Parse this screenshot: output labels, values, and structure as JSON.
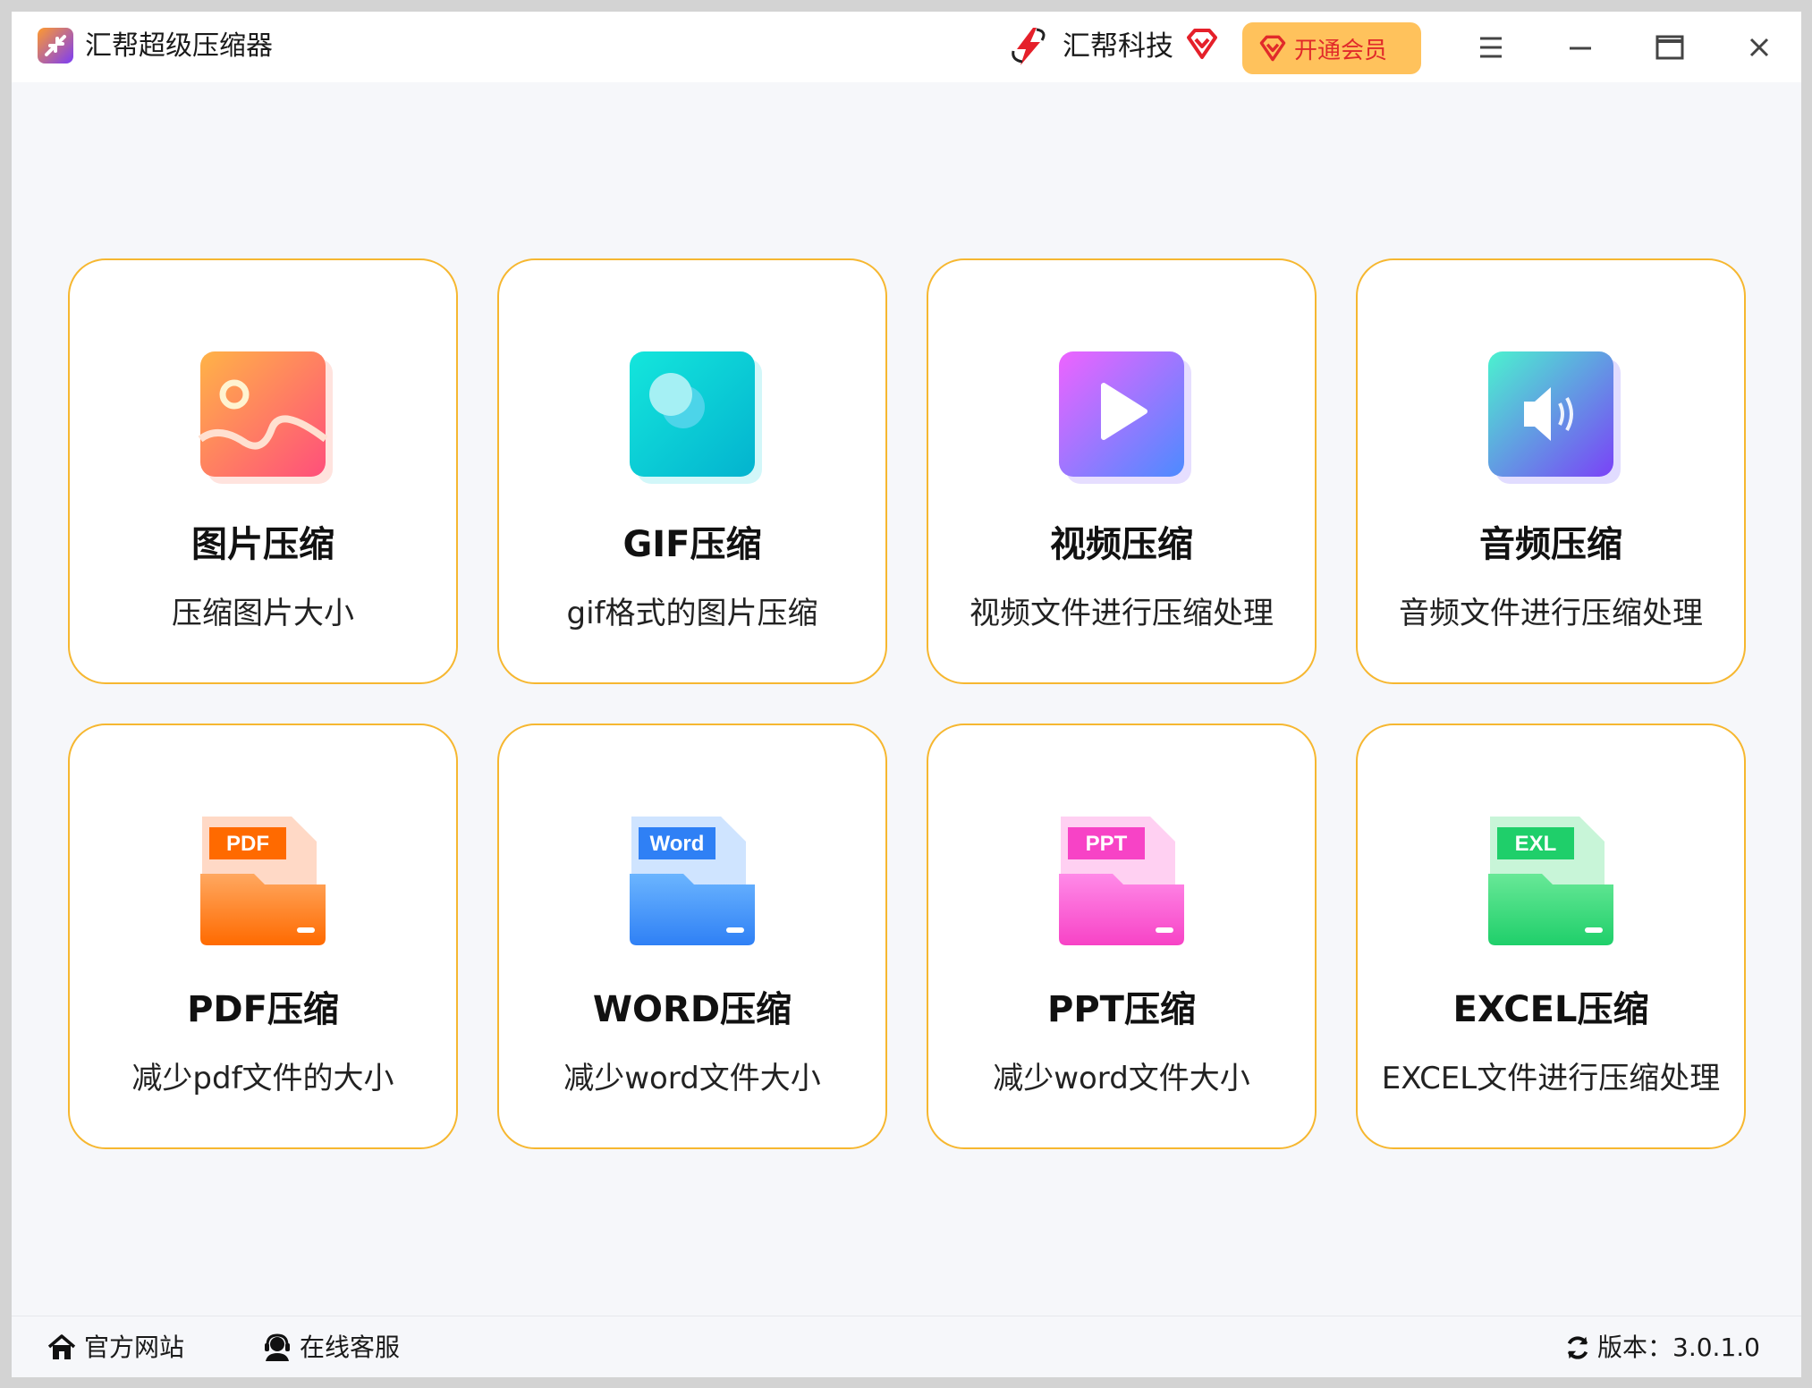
{
  "titlebar": {
    "app_title": "汇帮超级压缩器",
    "brand_name": "汇帮科技",
    "vip_label": "开通会员",
    "accent": "#ffc25c",
    "vip_text_color": "#e12a2a",
    "icons": [
      "compress-app-icon",
      "brand-bolt-icon",
      "diamond-icon",
      "menu-icon",
      "minimize-icon",
      "maximize-icon",
      "close-icon"
    ]
  },
  "cards": [
    {
      "title": "图片压缩",
      "desc": "压缩图片大小",
      "icon": "image-icon"
    },
    {
      "title": "GIF压缩",
      "desc": "gif格式的图片压缩",
      "icon": "gif-icon"
    },
    {
      "title": "视频压缩",
      "desc": "视频文件进行压缩处理",
      "icon": "video-play-icon"
    },
    {
      "title": "音频压缩",
      "desc": "音频文件进行压缩处理",
      "icon": "speaker-icon"
    },
    {
      "title": "PDF压缩",
      "desc": "减少pdf文件的大小",
      "icon": "pdf-folder-icon",
      "tag": "PDF"
    },
    {
      "title": "WORD压缩",
      "desc": "减少word文件大小",
      "icon": "word-folder-icon",
      "tag": "Word"
    },
    {
      "title": "PPT压缩",
      "desc": "减少word文件大小",
      "icon": "ppt-folder-icon",
      "tag": "PPT"
    },
    {
      "title": "EXCEL压缩",
      "desc": "EXCEL文件进行压缩处理",
      "icon": "excel-folder-icon",
      "tag": "EXL"
    }
  ],
  "card_border_color": "#f6b730",
  "footer": {
    "website_label": "官方网站",
    "support_label": "在线客服",
    "version_label": "版本：3.0.1.0",
    "icons": [
      "home-icon",
      "support-agent-icon",
      "refresh-icon"
    ]
  }
}
